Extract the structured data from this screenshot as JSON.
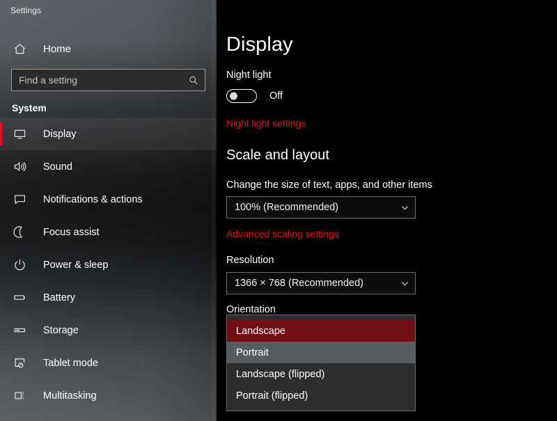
{
  "theme": {
    "accent": "#e81123",
    "selected_item_bg": "#6e0f13",
    "hover_item_bg": "#585c5e",
    "content_bg": "#000000"
  },
  "window": {
    "title": "Settings"
  },
  "sidebar": {
    "home": {
      "label": "Home",
      "icon": "home-icon"
    },
    "search": {
      "placeholder": "Find a setting",
      "value": "",
      "icon": "search-icon"
    },
    "group_header": "System",
    "items": [
      {
        "label": "Display",
        "icon": "monitor-icon",
        "selected": true
      },
      {
        "label": "Sound",
        "icon": "speaker-icon",
        "selected": false
      },
      {
        "label": "Notifications & actions",
        "icon": "notification-icon",
        "selected": false
      },
      {
        "label": "Focus assist",
        "icon": "moon-icon",
        "selected": false
      },
      {
        "label": "Power & sleep",
        "icon": "power-icon",
        "selected": false
      },
      {
        "label": "Battery",
        "icon": "battery-icon",
        "selected": false
      },
      {
        "label": "Storage",
        "icon": "storage-icon",
        "selected": false
      },
      {
        "label": "Tablet mode",
        "icon": "tablet-mode-icon",
        "selected": false
      },
      {
        "label": "Multitasking",
        "icon": "multitasking-icon",
        "selected": false
      }
    ]
  },
  "main": {
    "page_title": "Display",
    "night_light": {
      "label": "Night light",
      "toggle_state": "Off",
      "toggle_on": false,
      "settings_link": "Night light settings"
    },
    "scale_and_layout": {
      "heading": "Scale and layout",
      "scale_description": "Change the size of text, apps, and other items",
      "scale_value": "100% (Recommended)",
      "advanced_link": "Advanced scaling settings",
      "resolution_label": "Resolution",
      "resolution_value": "1366 × 768 (Recommended)",
      "orientation_label": "Orientation",
      "orientation_options": [
        {
          "label": "Landscape",
          "state": "selected"
        },
        {
          "label": "Portrait",
          "state": "hovered"
        },
        {
          "label": "Landscape (flipped)",
          "state": "normal"
        },
        {
          "label": "Portrait (flipped)",
          "state": "normal"
        }
      ]
    }
  }
}
